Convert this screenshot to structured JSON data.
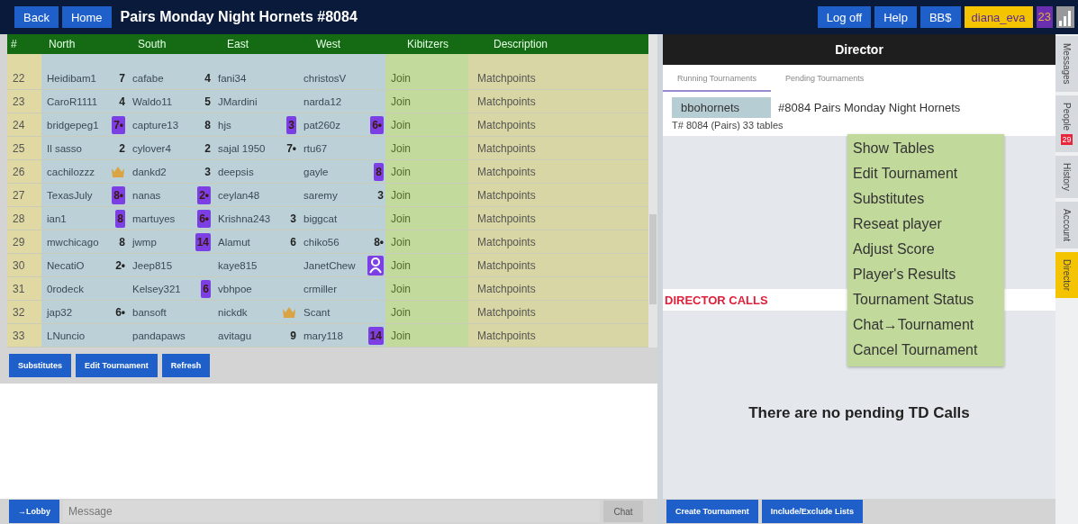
{
  "top_bar": {
    "nav_buttons": [
      "Back",
      "Home"
    ],
    "title": "Pairs Monday Night Hornets #8084",
    "right_buttons": [
      "Log off",
      "Help",
      "BB$"
    ],
    "username": "diana_eva",
    "user_count": "23"
  },
  "table": {
    "columns": [
      "#",
      "North",
      "South",
      "East",
      "West",
      "Kibitzers",
      "Description"
    ],
    "rows": [
      {
        "number": "22",
        "players": [
          {
            "name": "Heidibam1",
            "badge": "7",
            "kind": "plain"
          },
          {
            "name": "cafabe",
            "badge": "4",
            "kind": "plain"
          },
          {
            "name": "fani34",
            "kind": "none"
          },
          {
            "name": "christosV",
            "kind": "none"
          }
        ],
        "kibitzers": "Join",
        "description": "Matchpoints"
      },
      {
        "number": "23",
        "players": [
          {
            "name": "CaroR1111",
            "badge": "4",
            "kind": "plain"
          },
          {
            "name": "Waldo11",
            "badge": "5",
            "kind": "plain"
          },
          {
            "name": "JMardini",
            "kind": "none"
          },
          {
            "name": "narda12",
            "kind": "none"
          }
        ],
        "kibitzers": "Join",
        "description": "Matchpoints"
      },
      {
        "number": "24",
        "players": [
          {
            "name": "bridgepeg1",
            "badge": "7•",
            "kind": "box"
          },
          {
            "name": "capture13",
            "badge": "8",
            "kind": "plain"
          },
          {
            "name": "hjs",
            "badge": "3",
            "kind": "box"
          },
          {
            "name": "pat260z",
            "badge": "6•",
            "kind": "box"
          }
        ],
        "kibitzers": "Join",
        "description": "Matchpoints"
      },
      {
        "number": "25",
        "players": [
          {
            "name": "Il sasso",
            "badge": "2",
            "kind": "plain"
          },
          {
            "name": "cylover4",
            "badge": "2",
            "kind": "plain"
          },
          {
            "name": "sajal 1950",
            "badge": "7•",
            "kind": "plain"
          },
          {
            "name": "rtu67",
            "kind": "none"
          }
        ],
        "kibitzers": "Join",
        "description": "Matchpoints"
      },
      {
        "number": "26",
        "players": [
          {
            "name": "cachilozzz",
            "kind": "medal"
          },
          {
            "name": "dankd2",
            "badge": "3",
            "kind": "plain"
          },
          {
            "name": "deepsis",
            "kind": "none"
          },
          {
            "name": "gayle",
            "badge": "8",
            "kind": "box"
          }
        ],
        "kibitzers": "Join",
        "description": "Matchpoints"
      },
      {
        "number": "27",
        "players": [
          {
            "name": "TexasJuly",
            "badge": "8•",
            "kind": "box"
          },
          {
            "name": "nanas",
            "badge": "2•",
            "kind": "box"
          },
          {
            "name": "ceylan48",
            "kind": "none"
          },
          {
            "name": "saremy",
            "badge": "3",
            "kind": "plain"
          }
        ],
        "kibitzers": "Join",
        "description": "Matchpoints"
      },
      {
        "number": "28",
        "players": [
          {
            "name": "ian1",
            "badge": "8",
            "kind": "box"
          },
          {
            "name": "martuyes",
            "badge": "6•",
            "kind": "box"
          },
          {
            "name": "Krishna243",
            "badge": "3",
            "kind": "plain"
          },
          {
            "name": "biggcat",
            "kind": "none"
          }
        ],
        "kibitzers": "Join",
        "description": "Matchpoints"
      },
      {
        "number": "29",
        "players": [
          {
            "name": "mwchicago",
            "badge": "8",
            "kind": "plain"
          },
          {
            "name": "jwmp",
            "badge": "14",
            "kind": "box"
          },
          {
            "name": "Alamut",
            "badge": "6",
            "kind": "plain"
          },
          {
            "name": "chiko56",
            "badge": "8•",
            "kind": "plain"
          }
        ],
        "kibitzers": "Join",
        "description": "Matchpoints"
      },
      {
        "number": "30",
        "players": [
          {
            "name": "NecatiO",
            "badge": "2•",
            "kind": "plain"
          },
          {
            "name": "Jeep815",
            "kind": "none"
          },
          {
            "name": "kaye815",
            "kind": "none"
          },
          {
            "name": "JanetChew",
            "kind": "person"
          }
        ],
        "kibitzers": "Join",
        "description": "Matchpoints"
      },
      {
        "number": "31",
        "players": [
          {
            "name": "0rodeck",
            "kind": "none"
          },
          {
            "name": "Kelsey321",
            "badge": "6",
            "kind": "box"
          },
          {
            "name": "vbhpoe",
            "kind": "none"
          },
          {
            "name": "crmiller",
            "kind": "none"
          }
        ],
        "kibitzers": "Join",
        "description": "Matchpoints"
      },
      {
        "number": "32",
        "players": [
          {
            "name": "jap32",
            "badge": "6•",
            "kind": "plain"
          },
          {
            "name": "bansoft",
            "kind": "none"
          },
          {
            "name": "nickdk",
            "kind": "medal"
          },
          {
            "name": "Scant",
            "kind": "none"
          }
        ],
        "kibitzers": "Join",
        "description": "Matchpoints"
      },
      {
        "number": "33",
        "players": [
          {
            "name": "LNuncio",
            "kind": "none"
          },
          {
            "name": "pandapaws",
            "kind": "none"
          },
          {
            "name": "avitagu",
            "badge": "9",
            "kind": "plain"
          },
          {
            "name": "mary118",
            "badge": "14",
            "kind": "box"
          }
        ],
        "kibitzers": "Join",
        "description": "Matchpoints"
      }
    ]
  },
  "table_buttons": [
    "Substitutes",
    "Edit Tournament",
    "Refresh"
  ],
  "chat": {
    "channel_button": "→Lobby",
    "placeholder": "Message",
    "send_button": "Chat"
  },
  "director": {
    "title": "Director",
    "tabs": [
      {
        "label": "Running Tournaments",
        "selected": true
      },
      {
        "label": "Pending Tournaments",
        "selected": false
      }
    ],
    "tournament": {
      "host": "bbohornets",
      "name": "#8084 Pairs Monday Night Hornets",
      "info": "T# 8084 (Pairs) 33 tables"
    },
    "calls_heading": "DIRECTOR CALLS",
    "calls_message": "There are no pending TD Calls",
    "bottom_buttons": [
      "Create Tournament",
      "Include/Exclude Lists"
    ]
  },
  "context_menu": [
    "Show Tables",
    "Edit Tournament",
    "Substitutes",
    "Reseat player",
    "Adjust Score",
    "Player's Results",
    "Tournament Status",
    "Chat→Tournament",
    "Cancel Tournament"
  ],
  "side_tabs": [
    {
      "label": "Messages",
      "selected": false
    },
    {
      "label": "People",
      "badge": "29",
      "selected": false
    },
    {
      "label": "History",
      "selected": false
    },
    {
      "label": "Account",
      "selected": false
    },
    {
      "label": "Director",
      "selected": true
    }
  ]
}
